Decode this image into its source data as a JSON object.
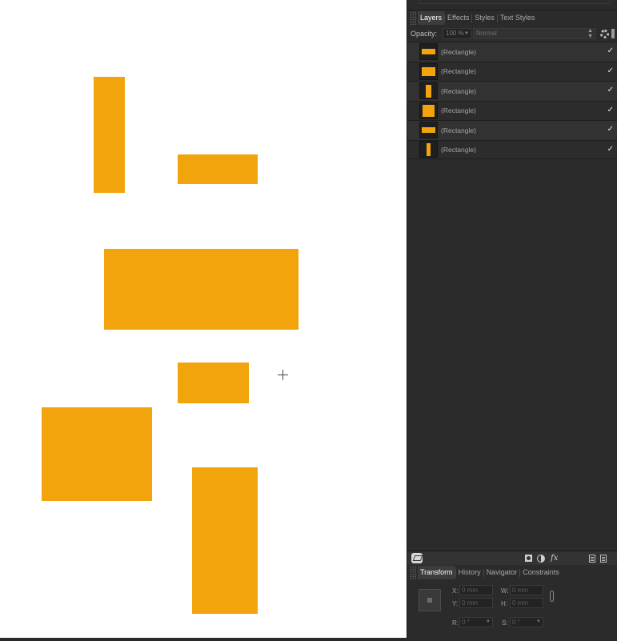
{
  "canvas": {
    "background": "#ffffff",
    "shape_color": "#f2a40c",
    "shapes": [
      "rectangle-1",
      "rectangle-2",
      "rectangle-3",
      "rectangle-4",
      "rectangle-5",
      "rectangle-6"
    ]
  },
  "layers_panel": {
    "tabs": [
      "Layers",
      "Effects",
      "Styles",
      "Text Styles"
    ],
    "active_tab": "Layers",
    "opacity_label": "Opacity:",
    "opacity_value": "100 %",
    "blend_mode": "Normal",
    "layers": [
      {
        "name": "(Rectangle)",
        "visible": "✓"
      },
      {
        "name": "(Rectangle)",
        "visible": "✓"
      },
      {
        "name": "(Rectangle)",
        "visible": "✓"
      },
      {
        "name": "(Rectangle)",
        "visible": "✓"
      },
      {
        "name": "(Rectangle)",
        "visible": "✓"
      },
      {
        "name": "(Rectangle)",
        "visible": "✓"
      }
    ],
    "toolbar_icons": [
      "layers-stack-icon",
      "mask-icon",
      "adjustment-icon",
      "fx-icon",
      "add-page-icon",
      "duplicate-icon"
    ]
  },
  "transform_panel": {
    "tabs": [
      "Transform",
      "History",
      "Navigator",
      "Constraints"
    ],
    "active_tab": "Transform",
    "x_label": "X:",
    "x_value": "0 mm",
    "y_label": "Y:",
    "y_value": "0 mm",
    "w_label": "W:",
    "w_value": "0 mm",
    "h_label": "H:",
    "h_value": "0 mm",
    "r_label": "R:",
    "r_value": "0 °",
    "s_label": "S:",
    "s_value": "0 °"
  }
}
